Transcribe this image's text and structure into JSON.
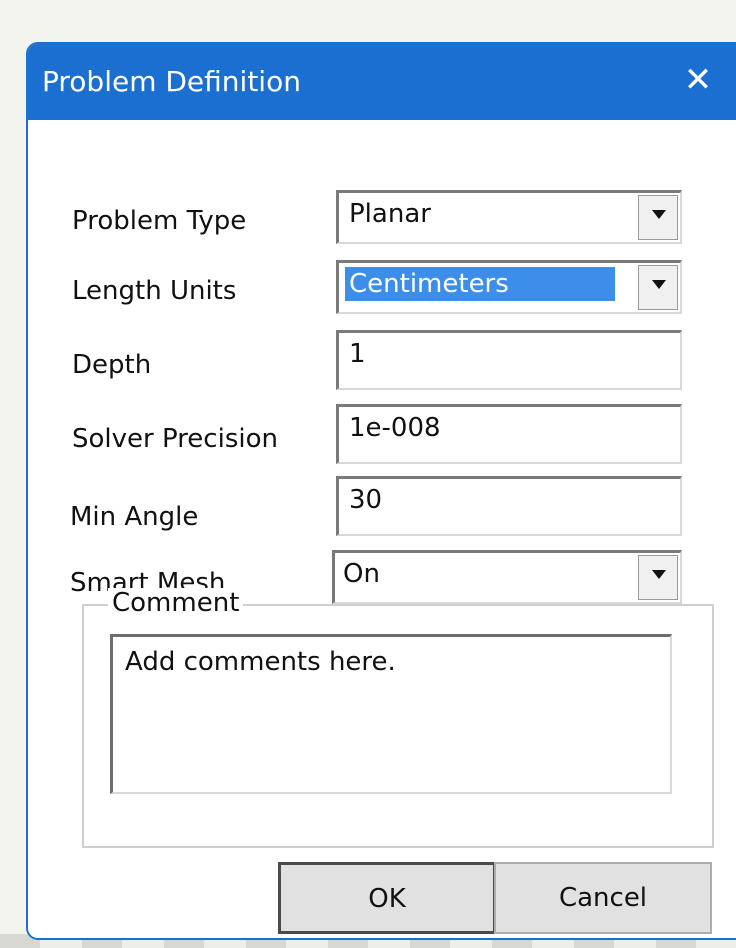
{
  "dialog": {
    "title": "Problem Definition",
    "close_glyph": "✕"
  },
  "fields": {
    "problem_type": {
      "label": "Problem Type",
      "value": "Planar"
    },
    "length_units": {
      "label": "Length Units",
      "value": "Centimeters"
    },
    "depth": {
      "label": "Depth",
      "value": "1"
    },
    "solver_precision": {
      "label": "Solver Precision",
      "value": "1e-008"
    },
    "min_angle": {
      "label": "Min Angle",
      "value": "30"
    },
    "smart_mesh": {
      "label": "Smart Mesh",
      "value": "On"
    }
  },
  "comment": {
    "legend": "Comment",
    "text": "Add comments here."
  },
  "buttons": {
    "ok": "OK",
    "cancel": "Cancel"
  },
  "colors": {
    "titlebar": "#1b6fd1",
    "selection": "#3d8eea"
  },
  "icons": {
    "close": "close-icon",
    "dropdown": "chevron-down-icon"
  }
}
